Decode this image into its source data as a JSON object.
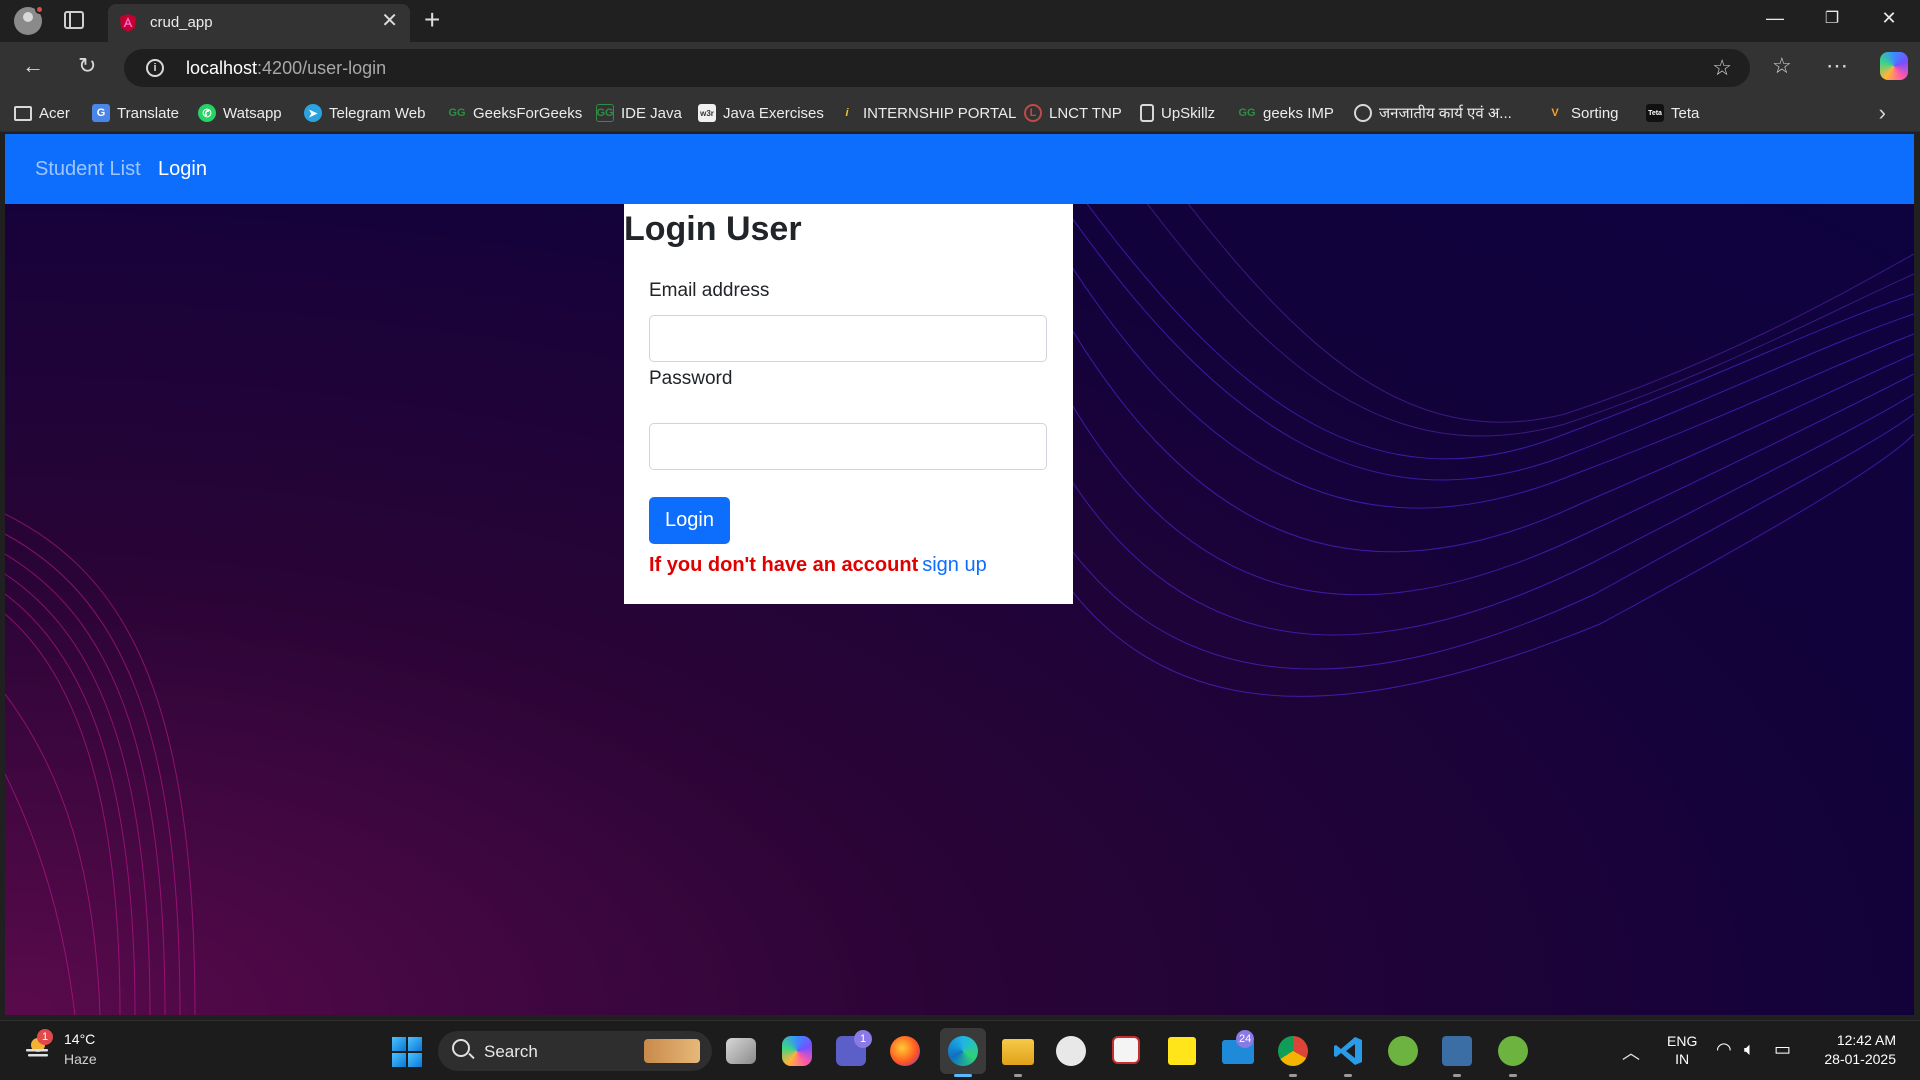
{
  "browser": {
    "tab_title": "crud_app",
    "url_host": "localhost",
    "url_path": ":4200/user-login",
    "bookmarks": [
      "Acer",
      "Translate",
      "Watsapp",
      "Telegram Web",
      "GeeksForGeeks",
      "IDE Java",
      "Java Exercises",
      "INTERNSHIP PORTAL",
      "LNCT TNP",
      "UpSkillz",
      "geeks IMP",
      "जनजातीय कार्य एवं अ...",
      "Sorting",
      "Teta"
    ]
  },
  "app_nav": {
    "student_list": "Student List",
    "login": "Login"
  },
  "login_card": {
    "title": "Login User",
    "email_label": "Email address",
    "email_value": "",
    "password_label": "Password",
    "password_value": "",
    "login_button": "Login",
    "no_account_text": "If you don't have an account",
    "signup_link": "sign up"
  },
  "taskbar": {
    "weather_badge": "1",
    "temperature": "14°C",
    "weather_desc": "Haze",
    "search_label": "Search",
    "teams_badge": "1",
    "mail_badge": "24",
    "lang_top": "ENG",
    "lang_bottom": "IN",
    "time": "12:42 AM",
    "date": "28-01-2025"
  },
  "colors": {
    "app_nav_bg": "#0d6efd",
    "primary_button": "#0d6efd",
    "error_text": "#e00000"
  }
}
